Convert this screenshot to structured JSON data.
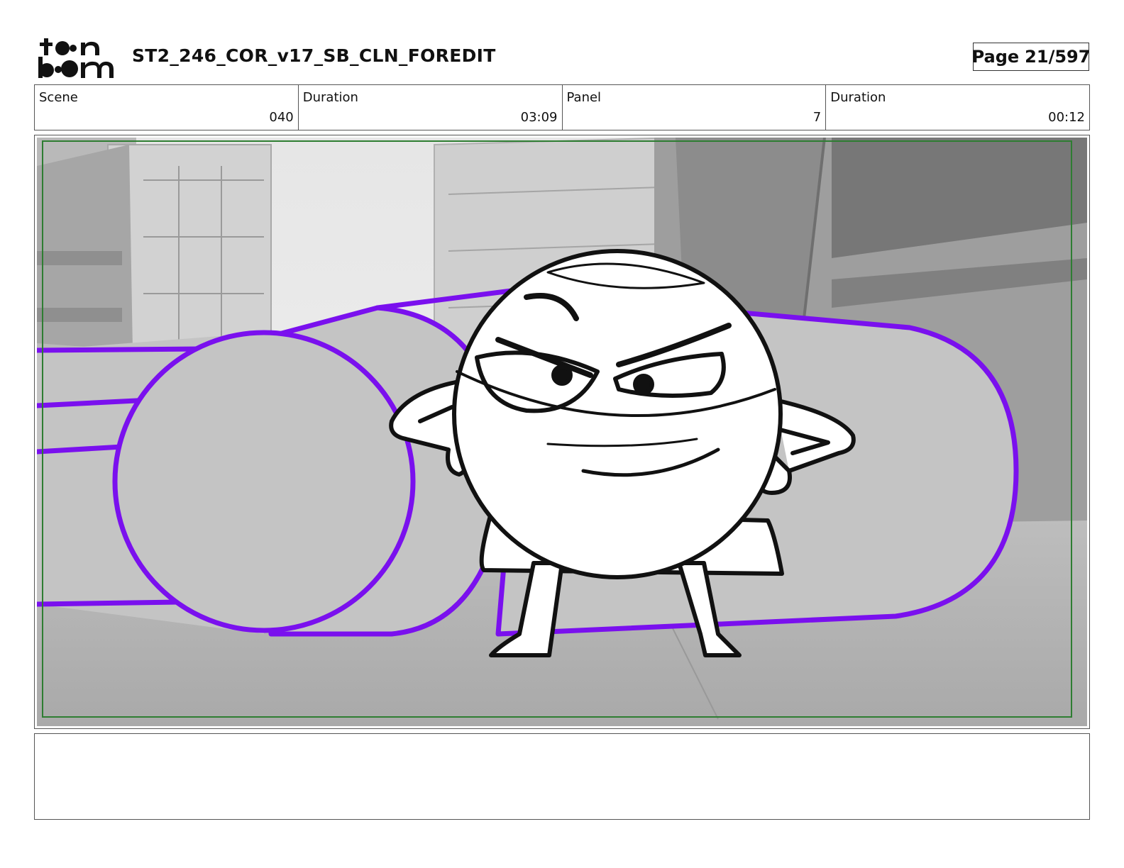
{
  "header": {
    "logo_top": "to•n",
    "logo_bottom": "b••m",
    "title": "ST2_246_COR_v17_SB_CLN_FOREDIT",
    "page_label": "Page",
    "page_number": "21/597"
  },
  "info": [
    {
      "label": "Scene",
      "value": "040"
    },
    {
      "label": "Duration",
      "value": "03:09"
    },
    {
      "label": "Panel",
      "value": "7"
    },
    {
      "label": "Duration",
      "value": "00:12"
    }
  ],
  "panel": {
    "description": "",
    "colors": {
      "capsule": "#7a10ee",
      "safe_frame": "#2e7d32",
      "background": "#c9c9c9"
    }
  },
  "notes": {
    "text": ""
  }
}
